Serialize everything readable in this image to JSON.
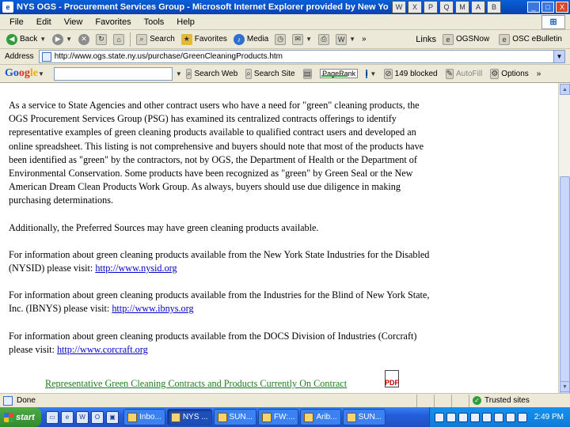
{
  "window": {
    "title": "NYS OGS - Procurement Services Group - Microsoft Internet Explorer provided by New Yo",
    "app_icon": "ie-icon",
    "taskbar_shortcuts": [
      "W",
      "X",
      "P",
      "Q",
      "M",
      "A",
      "B"
    ],
    "minimize": "_",
    "maximize": "□",
    "close": "X"
  },
  "menu": {
    "items": [
      "File",
      "Edit",
      "View",
      "Favorites",
      "Tools",
      "Help"
    ]
  },
  "toolbar": {
    "back": "Back",
    "search": "Search",
    "favorites": "Favorites",
    "media": "Media",
    "more": "»",
    "links_label": "Links",
    "link1": "OGSNow",
    "link2": "OSC eBulletin"
  },
  "address": {
    "label": "Address",
    "url": "http://www.ogs.state.ny.us/purchase/GreenCleaningProducts.htm"
  },
  "google_bar": {
    "logo_parts": [
      "Go",
      "og",
      "le"
    ],
    "search_web": "Search Web",
    "search_site": "Search Site",
    "pagerank": "PageRank",
    "blocked": "149 blocked",
    "autofill": "AutoFill",
    "options": "Options",
    "more": "»"
  },
  "content": {
    "paragraph1": "As a service to State Agencies and other contract users who have a need for \"green\" cleaning products, the OGS Procurement Services Group (PSG) has examined its centralized contracts offerings to identify representative examples of green cleaning products available to qualified contract users and developed an online spreadsheet. This listing is not comprehensive and buyers should note that most of the products have been identified as \"green\" by the contractors, not by OGS, the Department of Health or the Department of Environmental Conservation. Some products have been recognized as \"green\" by Green Seal or the New American Dream Clean Products Work Group. As always, buyers should use due diligence in making purchasing determinations.",
    "paragraph2": "Additionally, the Preferred Sources may have green cleaning products available.",
    "nysid_text": "For information about green cleaning products available from the New York State Industries for the Disabled (NYSID) please visit: ",
    "nysid_link": "http://www.nysid.org",
    "ibnys_text": "For information about green cleaning products available from the Industries for the Blind of New York State, Inc. (IBNYS) please visit: ",
    "ibnys_link": "http://www.ibnys.org",
    "docs_text": "For information about green cleaning products available from the DOCS Division of Industries (Corcraft) please visit: ",
    "docs_link": "http://www.corcraft.org",
    "bottom_link": "Representative Green Cleaning Contracts and Products Currently On Contract",
    "pdf_label": "PDF"
  },
  "status": {
    "text": "Done",
    "zone": "Trusted sites"
  },
  "taskbar": {
    "start": "start",
    "tasks": [
      "Inbo...",
      "NYS ...",
      "SUN...",
      "FW:...",
      "Arib...",
      "SUN..."
    ],
    "active_index": 1,
    "clock": "2:49 PM"
  }
}
